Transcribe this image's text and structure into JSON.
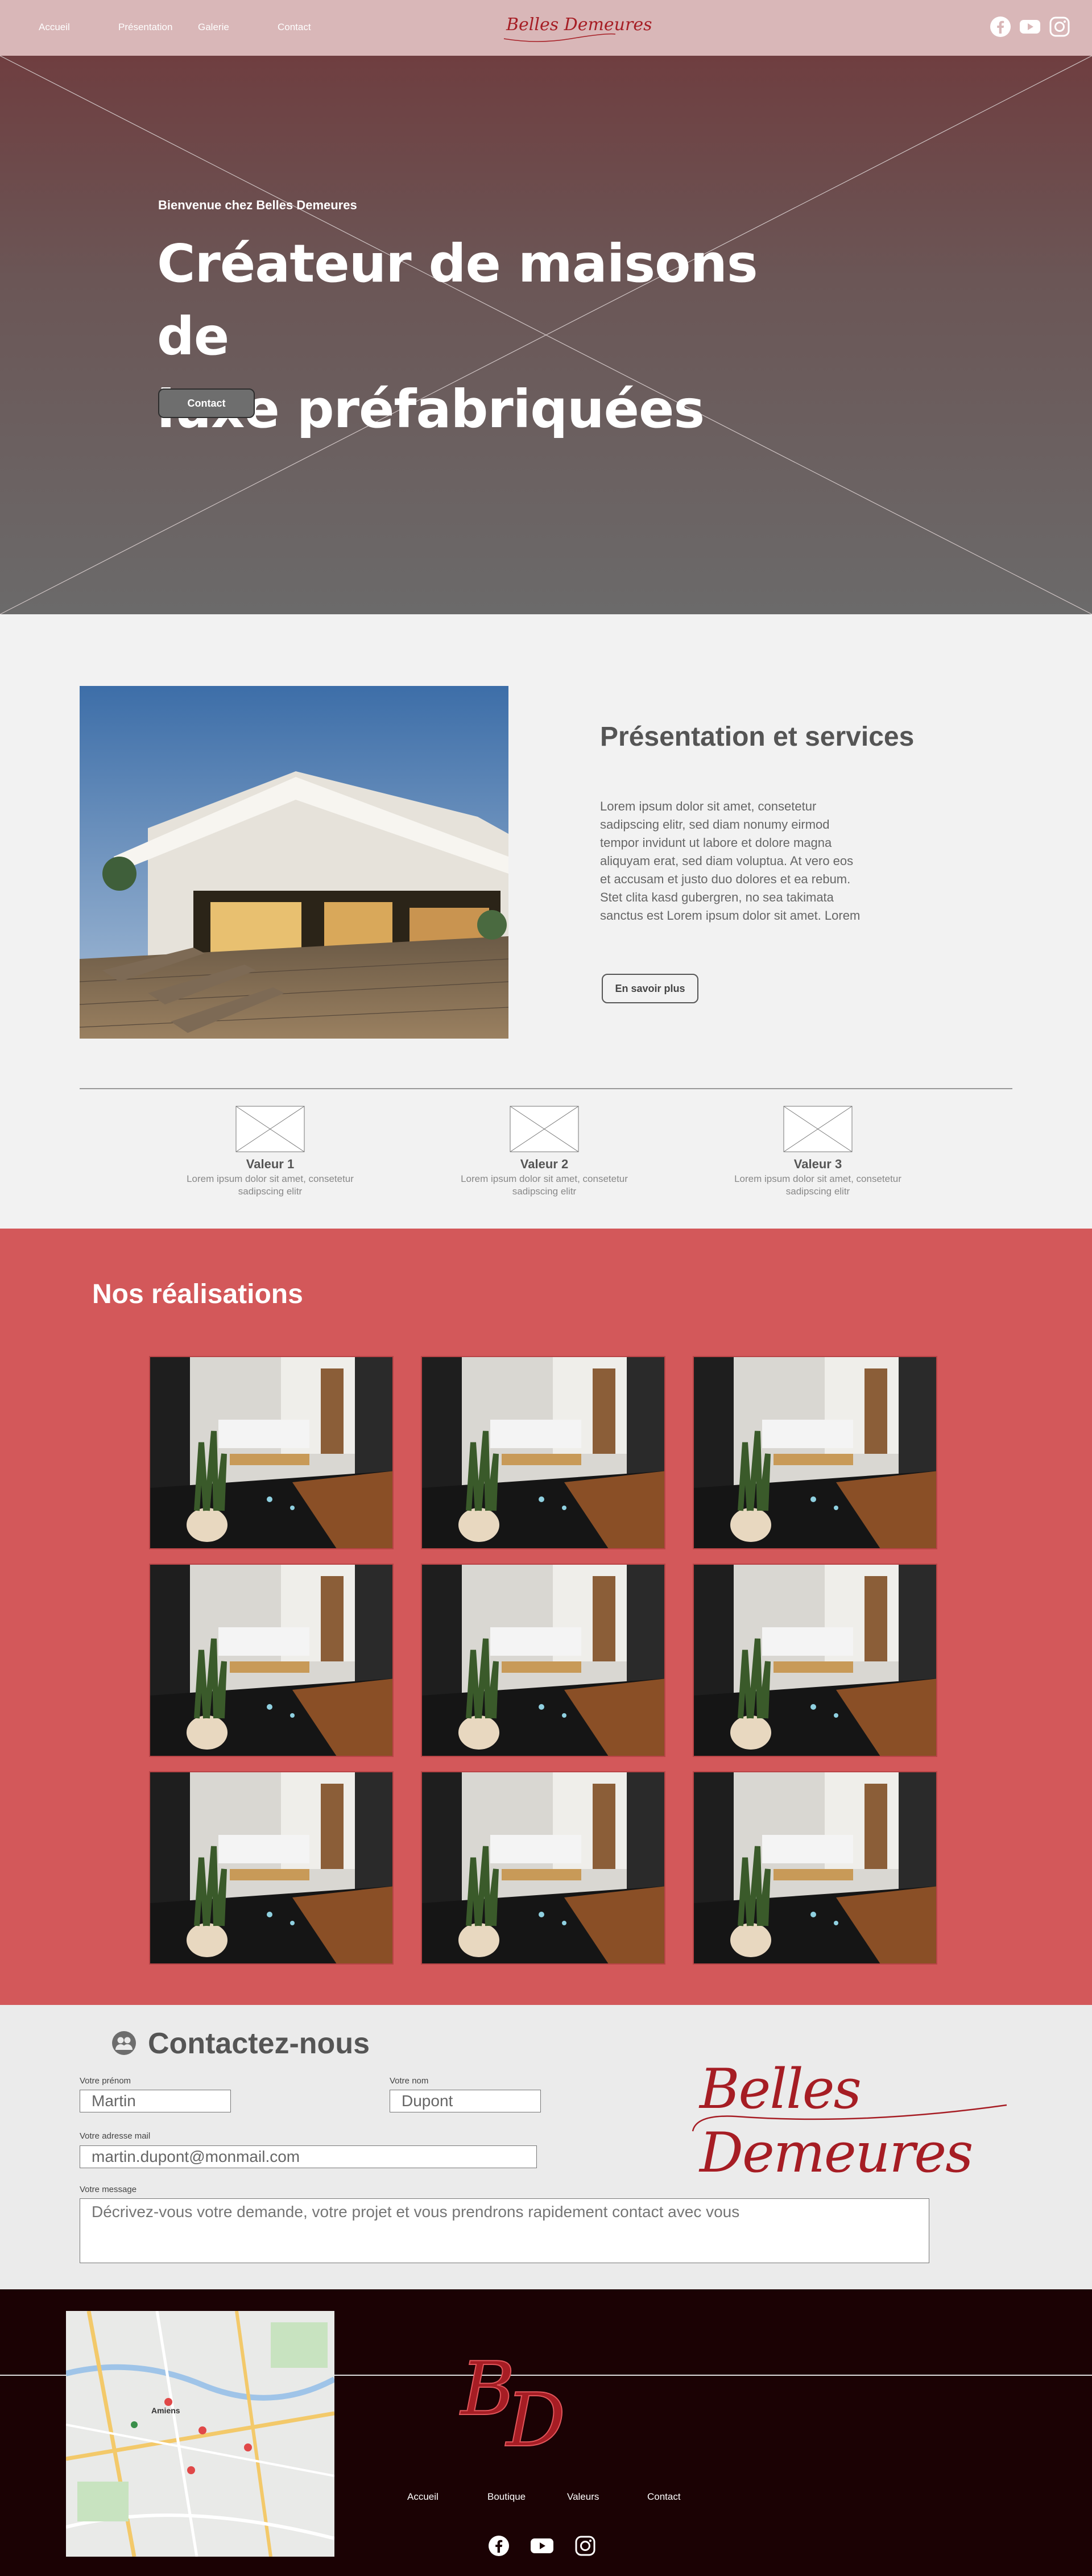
{
  "header": {
    "nav": [
      "Accueil",
      "Présentation",
      "Galerie",
      "Contact"
    ],
    "logo_text": "Belles Demeures",
    "social_icons": [
      "facebook-icon",
      "youtube-icon",
      "instagram-icon"
    ]
  },
  "hero": {
    "kicker": "Bienvenue chez Belles Demeures",
    "title_line1": "Créateur de maisons de",
    "title_line2": "luxe préfabriquées",
    "button": "Contact"
  },
  "presentation": {
    "title": "Présentation et services",
    "text": "Lorem ipsum dolor sit amet, consetetur sadipscing elitr, sed diam nonumy eirmod tempor invidunt ut labore et dolore magna aliquyam erat, sed diam voluptua. At vero eos et accusam et justo duo dolores et ea rebum. Stet clita kasd gubergren, no sea takimata sanctus est Lorem ipsum dolor sit amet. Lorem",
    "button": "En savoir plus",
    "values": [
      {
        "title": "Valeur 1",
        "text": "Lorem ipsum dolor sit amet, consetetur sadipscing elitr"
      },
      {
        "title": "Valeur 2",
        "text": "Lorem ipsum dolor sit amet, consetetur sadipscing elitr"
      },
      {
        "title": "Valeur 3",
        "text": "Lorem ipsum dolor sit amet, consetetur sadipscing elitr"
      }
    ]
  },
  "realisations": {
    "title": "Nos réalisations"
  },
  "contact": {
    "title": "Contactez-nous",
    "firstname_label": "Votre prénom",
    "firstname_value": "Martin",
    "lastname_label": "Votre nom",
    "lastname_value": "Dupont",
    "email_label": "Votre adresse mail",
    "email_value": "martin.dupont@monmail.com",
    "message_label": "Votre message",
    "message_placeholder": "Décrivez-vous votre demande, votre projet et vous prendrons rapidement contact avec vous",
    "logo_text": "Belles Demeures"
  },
  "footer": {
    "nav": [
      "Accueil",
      "Boutique",
      "Valeurs",
      "Contact"
    ],
    "logo_letters": "BD",
    "map_labels": [
      "Amiens"
    ],
    "social_icons": [
      "facebook-icon",
      "youtube-icon",
      "instagram-icon"
    ]
  },
  "colors": {
    "header_bg": "#d9b7b8",
    "accent_red": "#d3585a",
    "brand_red": "#a61d24",
    "footer_bg": "#1b0204"
  }
}
